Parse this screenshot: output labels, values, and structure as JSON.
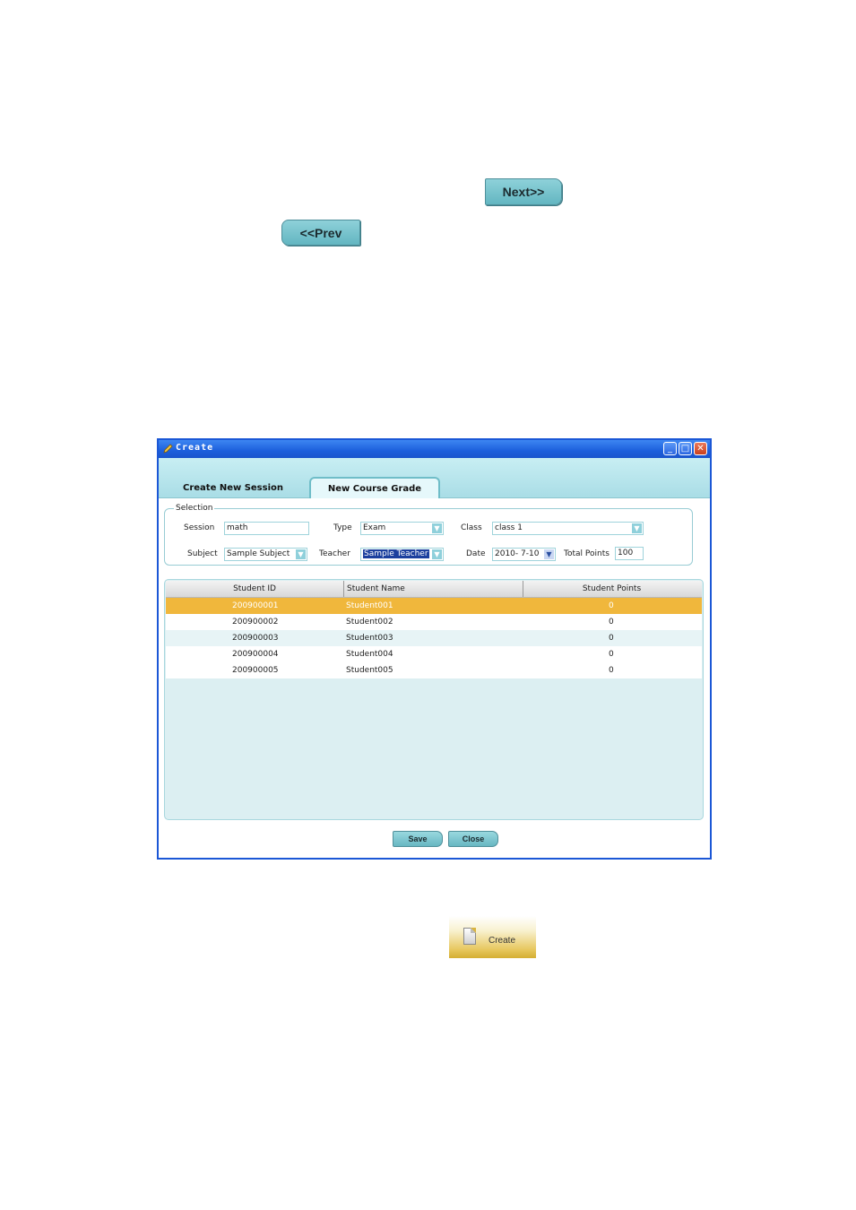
{
  "nav": {
    "next_label": "Next>>",
    "prev_label": "<<Prev"
  },
  "window": {
    "title": "Create",
    "tabs": [
      "Create New Session",
      "New Course Grade"
    ],
    "active_tab": "New Course Grade",
    "selection": {
      "legend": "Selection",
      "session_label": "Session",
      "session_value": "math",
      "type_label": "Type",
      "type_value": "Exam",
      "class_label": "Class",
      "class_value": "class 1",
      "subject_label": "Subject",
      "subject_value": "Sample Subject",
      "teacher_label": "Teacher",
      "teacher_value": "Sample Teacher",
      "date_label": "Date",
      "date_value": "2010- 7-10",
      "total_points_label": "Total Points",
      "total_points_value": "100"
    },
    "table": {
      "columns": [
        "Student ID",
        "Student Name",
        "Student Points"
      ],
      "rows": [
        [
          "200900001",
          "Student001",
          "0"
        ],
        [
          "200900002",
          "Student002",
          "0"
        ],
        [
          "200900003",
          "Student003",
          "0"
        ],
        [
          "200900004",
          "Student004",
          "0"
        ],
        [
          "200900005",
          "Student005",
          "0"
        ]
      ],
      "selected_row": 0
    },
    "buttons": {
      "save": "Save",
      "close": "Close"
    }
  },
  "toolbar": {
    "create_label": "Create",
    "create_icon": "document-icon"
  },
  "colors": {
    "accent": "#6fbdc8",
    "title_bar": "#1c5fdc",
    "selected_row": "#f0b73c"
  }
}
